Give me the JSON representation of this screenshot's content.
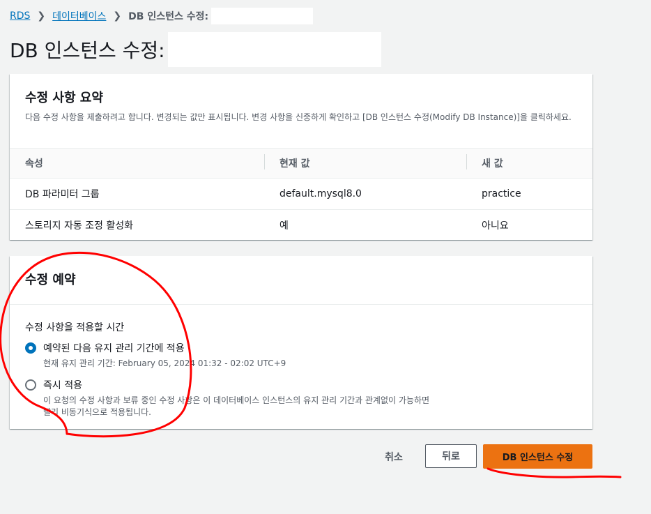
{
  "breadcrumb": {
    "items": [
      {
        "label": "RDS"
      },
      {
        "label": "데이터베이스"
      }
    ],
    "current": "DB 인스턴스 수정:"
  },
  "page": {
    "title": "DB 인스턴스 수정:"
  },
  "summary": {
    "title": "수정 사항 요약",
    "description": "다음 수정 사항을 제출하려고 합니다. 변경되는 값만 표시됩니다. 변경 사항을 신중하게 확인하고 [DB 인스턴스 수정(Modify DB Instance)]을 클릭하세요.",
    "columns": [
      "속성",
      "현재 값",
      "새 값"
    ],
    "rows": [
      {
        "attribute": "DB 파라미터 그룹",
        "current": "default.mysql8.0",
        "new": "practice"
      },
      {
        "attribute": "스토리지 자동 조정 활성화",
        "current": "예",
        "new": "아니요"
      }
    ]
  },
  "schedule": {
    "title": "수정 예약",
    "field_label": "수정 사항을 적용할 시간",
    "options": [
      {
        "label": "예약된 다음 유지 관리 기간에 적용",
        "description": "현재 유지 관리 기간: February 05, 2024 01:32 - 02:02 UTC+9",
        "selected": true
      },
      {
        "label": "즉시 적용",
        "description": "이 요청의 수정 사항과 보류 중인 수정 사항은 이 데이터베이스 인스턴스의 유지 관리 기간과 관계없이 가능하면 빨리 비동기식으로 적용됩니다.",
        "selected": false
      }
    ]
  },
  "actions": {
    "cancel": "취소",
    "back": "뒤로",
    "submit": "DB 인스턴스 수정"
  },
  "colors": {
    "link": "#0073bb",
    "primary": "#ec7211",
    "annotation": "#ff0000",
    "background": "#f2f3f3"
  }
}
